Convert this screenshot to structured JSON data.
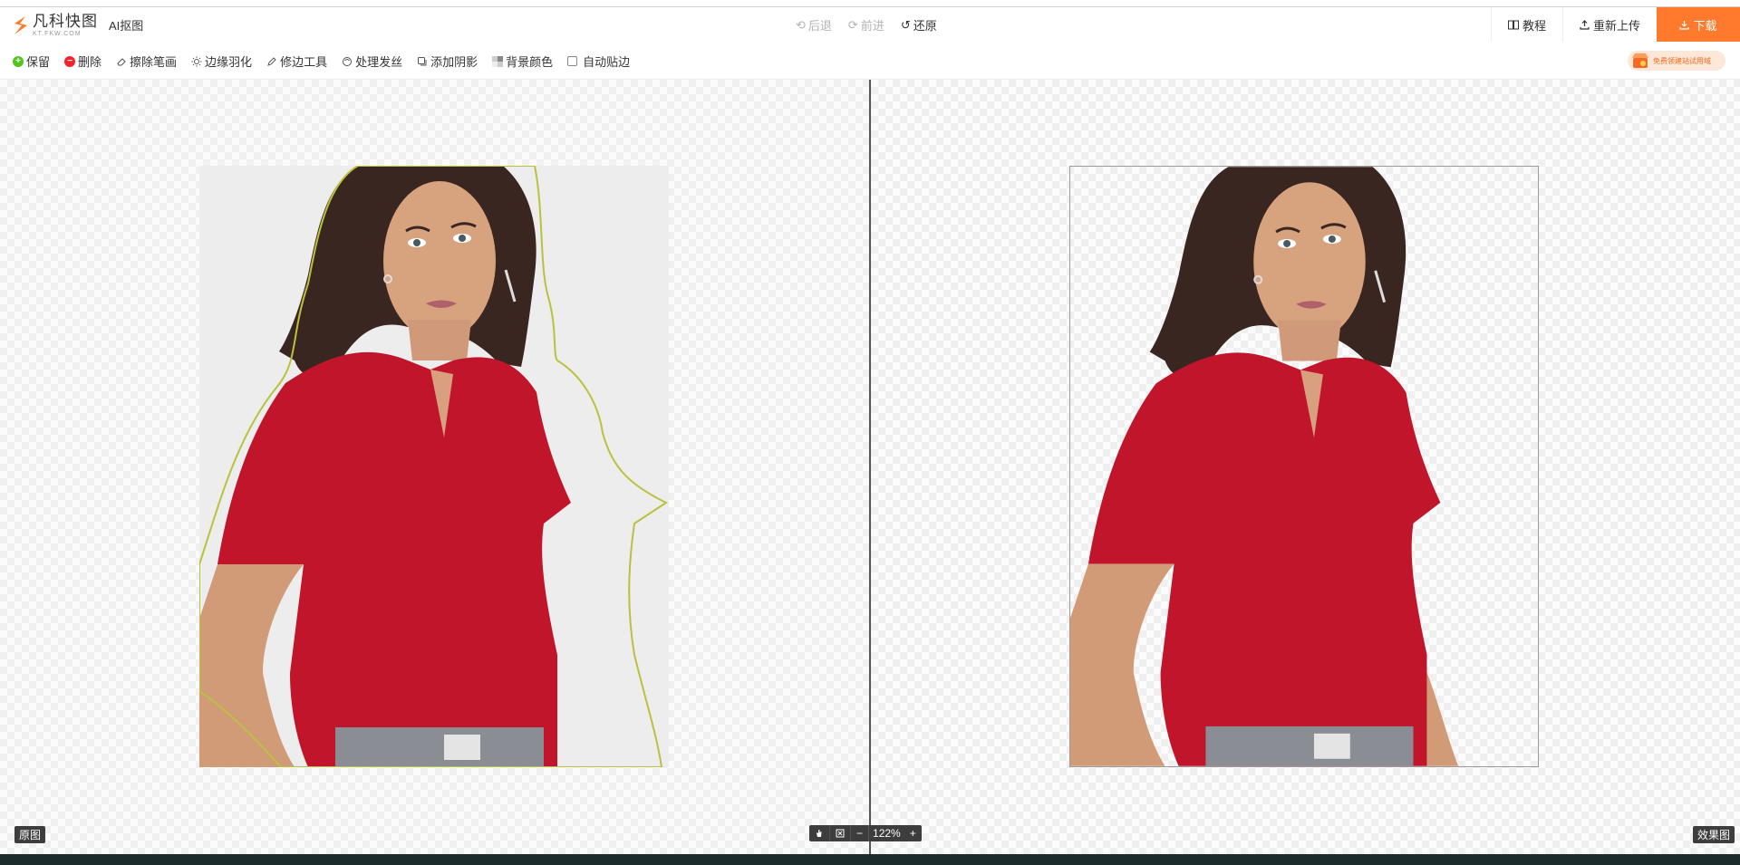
{
  "header": {
    "logo": {
      "name": "凡科快图",
      "subtitle": "KT.FKW.COM"
    },
    "app_title": "AI抠图",
    "undo_label": "后退",
    "redo_label": "前进",
    "restore_label": "还原",
    "tutorial_label": "教程",
    "reupload_label": "重新上传",
    "download_label": "下载"
  },
  "toolbar": {
    "keep_label": "保留",
    "delete_label": "删除",
    "erase_label": "擦除笔画",
    "feather_label": "边缘羽化",
    "edge_tool_label": "修边工具",
    "hair_label": "处理发丝",
    "shadow_label": "添加阴影",
    "bg_color_label": "背景颜色",
    "auto_snap_label": "自动贴边",
    "auto_snap_checked": false,
    "promo_text": "免费领建站试用域"
  },
  "canvas": {
    "original_label": "原图",
    "result_label": "效果图",
    "zoom_value": "122%"
  },
  "colors": {
    "accent": "#ff7a2c",
    "selection_outline": "#b9c23c",
    "shirt": "#c0152b"
  }
}
